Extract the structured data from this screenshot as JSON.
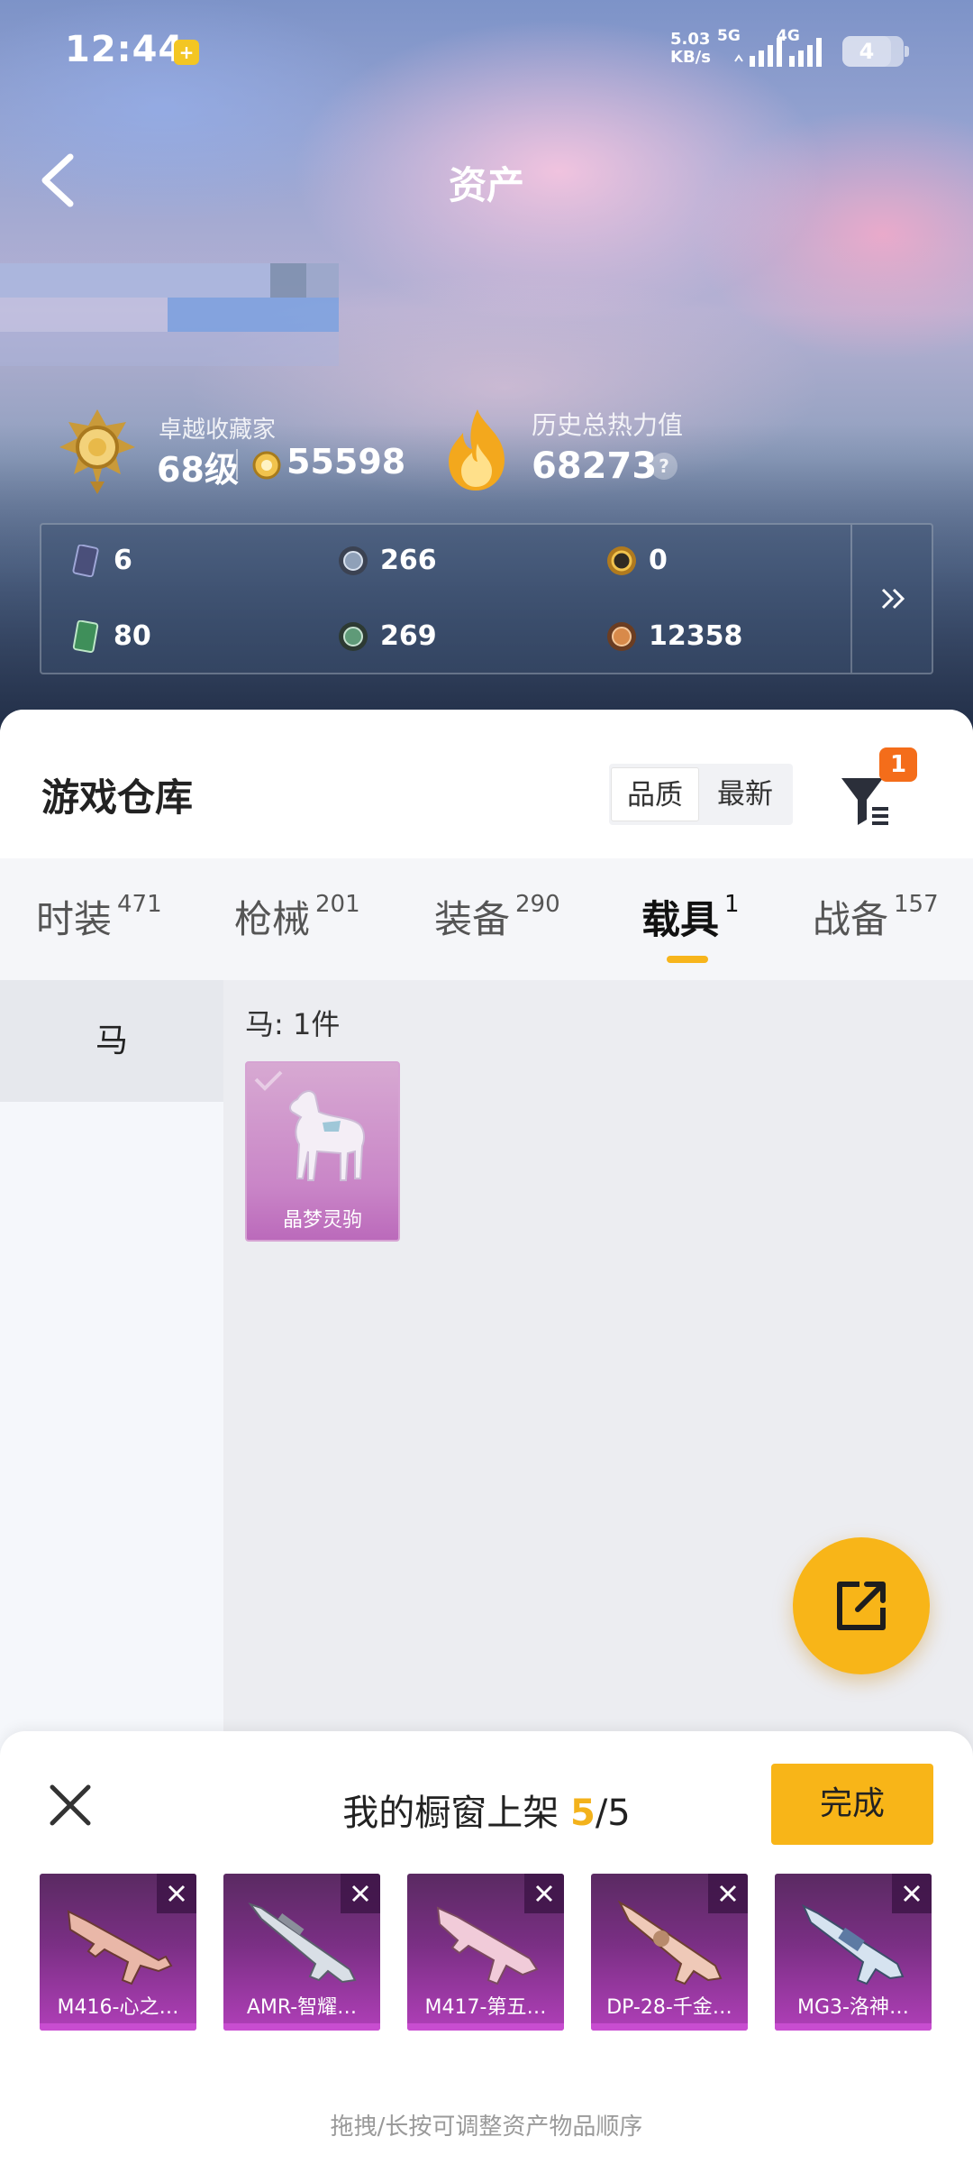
{
  "status_bar": {
    "time": "12:44",
    "net_speed_value": "5.03",
    "net_speed_unit": "KB/s",
    "net_type_1": "5G",
    "net_type_2": "4G",
    "battery": "4"
  },
  "header": {
    "title": "资产"
  },
  "collector": {
    "title": "卓越收藏家",
    "level": "68级",
    "coins": "55598"
  },
  "heat": {
    "title": "历史总热力值",
    "value": "68273",
    "help": "?"
  },
  "currencies": [
    {
      "icon": "card-icon",
      "value": "6"
    },
    {
      "icon": "silver-coin-icon",
      "value": "266"
    },
    {
      "icon": "gold-coin-icon",
      "value": "0"
    },
    {
      "icon": "ticket-icon",
      "value": "80"
    },
    {
      "icon": "green-gem-icon",
      "value": "269"
    },
    {
      "icon": "bronze-coin-icon",
      "value": "12358"
    }
  ],
  "warehouse": {
    "title": "游戏仓库",
    "sort_options": [
      "品质",
      "最新"
    ],
    "filter_badge": "1",
    "tabs": [
      {
        "label": "时装",
        "count": "471"
      },
      {
        "label": "枪械",
        "count": "201"
      },
      {
        "label": "装备",
        "count": "290"
      },
      {
        "label": "载具",
        "count": "1",
        "active": true
      },
      {
        "label": "战备",
        "count": "157"
      }
    ],
    "sidebar": [
      {
        "label": "马"
      }
    ],
    "category_count": "马: 1件",
    "items": [
      {
        "name": "晶梦灵驹"
      }
    ]
  },
  "showcase": {
    "title_prefix": "我的橱窗上架",
    "current": "5",
    "total": "/5",
    "done_label": "完成",
    "hint": "拖拽/长按可调整资产物品顺序",
    "slots": [
      {
        "name": "M416-心之…"
      },
      {
        "name": "AMR-智耀…"
      },
      {
        "name": "M417-第五…"
      },
      {
        "name": "DP-28-千金…"
      },
      {
        "name": "MG3-洛神…"
      }
    ]
  },
  "colors": {
    "accent": "#f8b518",
    "badge": "#f46d1a",
    "rare_purple": "#b03fb8"
  }
}
